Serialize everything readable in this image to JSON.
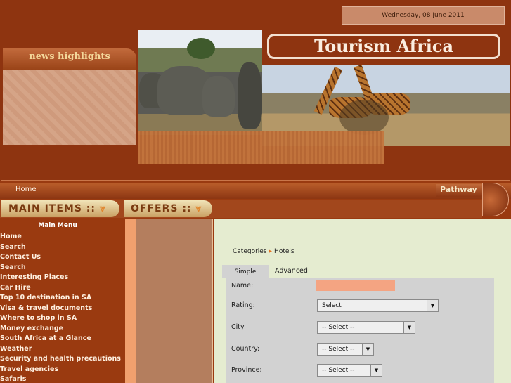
{
  "header": {
    "date": "Wednesday, 08 June 2011",
    "site_title": "Tourism Africa",
    "news_title": "news highlights"
  },
  "nav": {
    "home": "Home",
    "pathway": "Pathway"
  },
  "tabs": {
    "main_items": "MAIN ITEMS ::",
    "offers": "OFFERS ::"
  },
  "menu": {
    "heading": "Main Menu",
    "items": [
      "Home",
      "Search",
      "Contact Us",
      "Search",
      "Interesting Places",
      "Car Hire",
      "Top 10 destination in SA",
      "Visa & travel documents",
      "Where to shop in SA",
      "Money exchange",
      "South Africa at a Glance",
      "Weather",
      "Security and health precautions",
      "Travel agencies",
      "Safaris"
    ]
  },
  "breadcrumb": {
    "categories": "Categories",
    "separator": "▸",
    "current": "Hotels"
  },
  "search": {
    "tab_simple": "Simple",
    "tab_advanced": "Advanced",
    "name_label": "Name:",
    "name_value": "",
    "rating_label": "Rating:",
    "rating_value": "Select",
    "city_label": "City:",
    "city_value": "-- Select --",
    "country_label": "Country:",
    "country_value": "-- Select --",
    "province_label": "Province:",
    "province_value": "-- Select --"
  },
  "colors": {
    "brand": "#8e3410",
    "accent": "#f0a06e",
    "content_bg": "#e5ecd0"
  }
}
